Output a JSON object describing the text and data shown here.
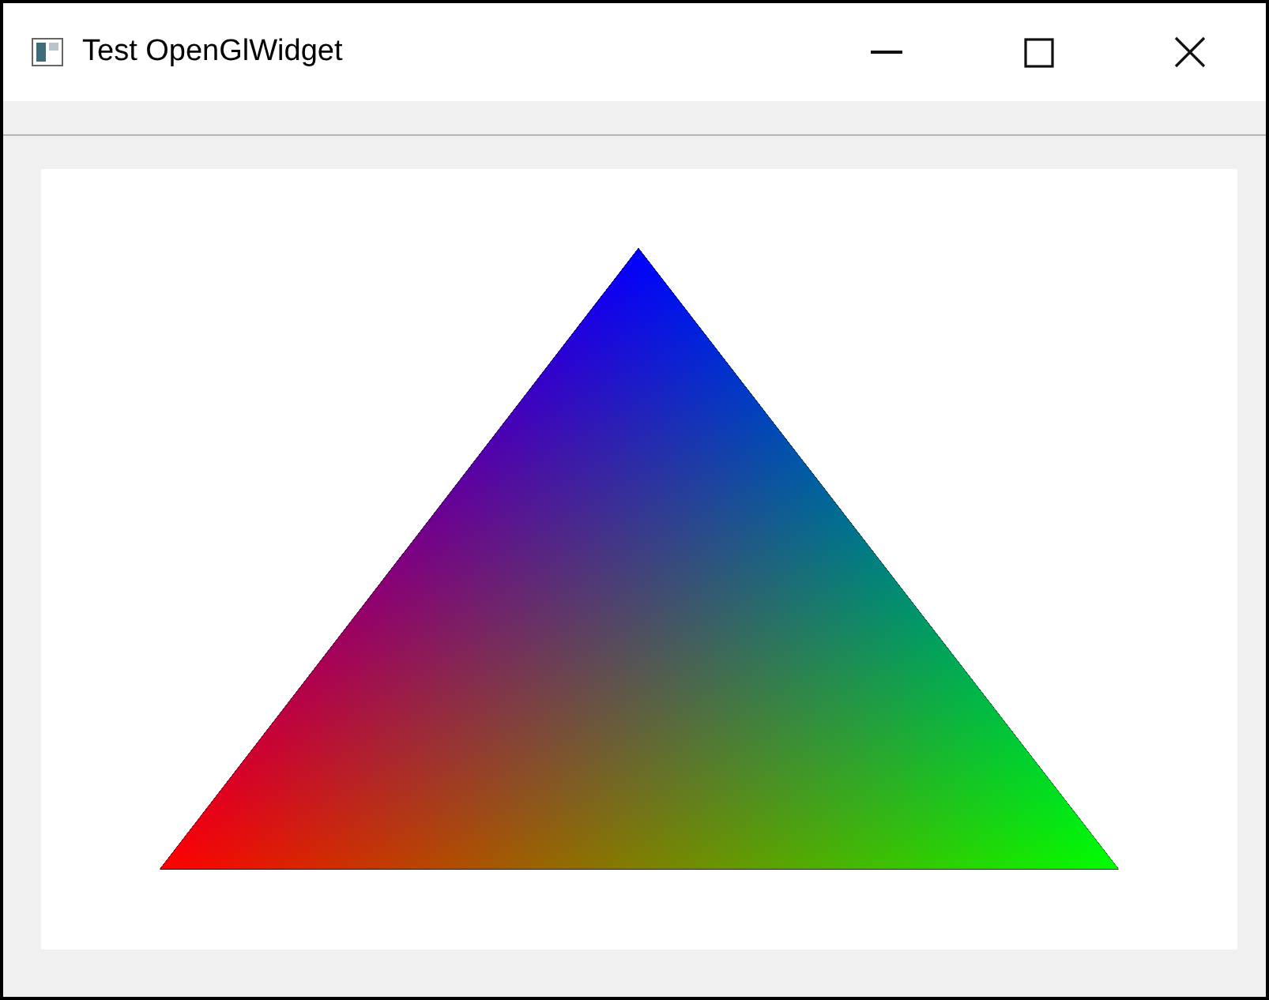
{
  "window": {
    "title": "Test OpenGlWidget"
  }
}
